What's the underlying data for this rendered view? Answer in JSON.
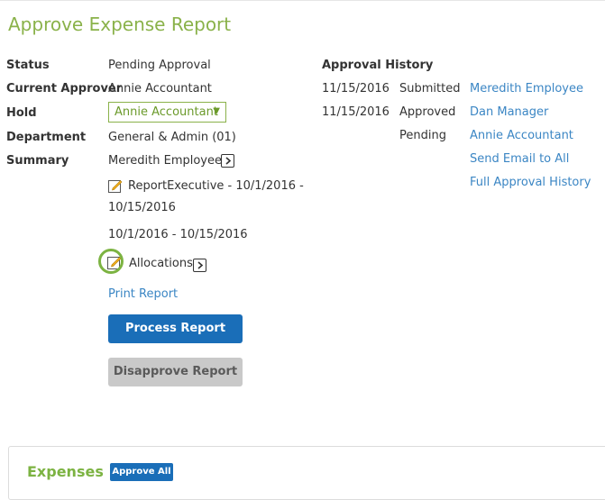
{
  "page": {
    "title": "Approve Expense Report"
  },
  "details": {
    "status_label": "Status",
    "status_value": "Pending Approval",
    "current_approver_label": "Current Approver",
    "current_approver_value": "Annie Accountant",
    "hold_label": "Hold",
    "hold_selected": "Annie Accountant",
    "department_label": "Department",
    "department_value": "General & Admin (01)",
    "summary_label": "Summary",
    "summary_employee": "Meredith Employee",
    "report_line1": "ReportExecutive - 10/1/2016 -",
    "report_line2": "10/15/2016",
    "date_range": "10/1/2016 - 10/15/2016",
    "allocations": "Allocations",
    "print_report": "Print Report"
  },
  "actions": {
    "process_report": "Process Report",
    "disapprove_report": "Disapprove Report"
  },
  "approval_history": {
    "title": "Approval History",
    "rows": [
      {
        "date": "11/15/2016",
        "status": "Submitted",
        "person": "Meredith Employee"
      },
      {
        "date": "11/15/2016",
        "status": "Approved",
        "person": "Dan Manager"
      },
      {
        "date": "",
        "status": "Pending",
        "person": "Annie Accountant"
      }
    ],
    "send_email": "Send Email to All",
    "full_history": "Full Approval History"
  },
  "expenses": {
    "title": "Expenses",
    "approve_all": "Approve All"
  },
  "colors": {
    "title_green": "#8ab24a",
    "link_blue": "#3b86c4",
    "primary_blue": "#1a6eb8",
    "highlight_ring": "#7cb342"
  },
  "icons": {
    "edit": "pencil-icon",
    "expand": "chevron-right-icon",
    "dropdown": "caret-down-icon"
  }
}
